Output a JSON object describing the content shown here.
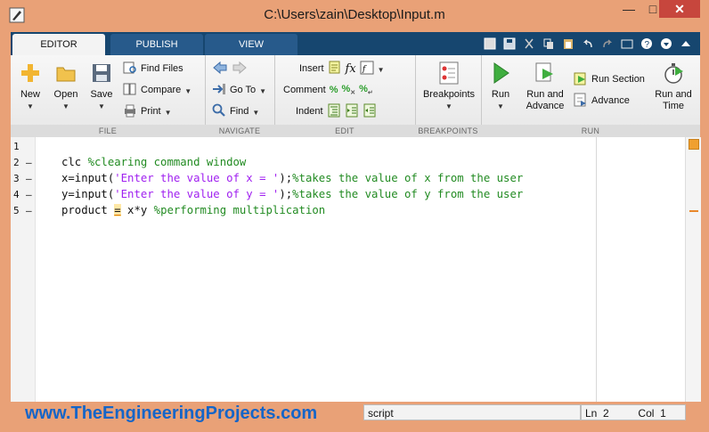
{
  "window": {
    "title": "C:\\Users\\zain\\Desktop\\Input.m",
    "minimize": "—",
    "maximize": "□",
    "close": "✕"
  },
  "tabs": [
    {
      "label": "EDITOR"
    },
    {
      "label": "PUBLISH"
    },
    {
      "label": "VIEW"
    }
  ],
  "ribbon": {
    "file": {
      "label": "FILE",
      "new": "New",
      "open": "Open",
      "save": "Save",
      "find_files": "Find Files",
      "compare": "Compare",
      "print": "Print"
    },
    "navigate": {
      "label": "NAVIGATE",
      "go_to": "Go To",
      "find": "Find"
    },
    "edit": {
      "label": "EDIT",
      "insert": "Insert",
      "comment": "Comment",
      "indent": "Indent"
    },
    "breakpoints": {
      "label": "BREAKPOINTS",
      "breakpoints": "Breakpoints"
    },
    "run": {
      "label": "RUN",
      "run": "Run",
      "run_and_advance_1": "Run and",
      "run_and_advance_2": "Advance",
      "run_section": "Run Section",
      "advance": "Advance",
      "run_and_time_1": "Run and",
      "run_and_time_2": "Time"
    }
  },
  "code": {
    "line_numbers": [
      "1",
      "2",
      "3",
      "4",
      "5"
    ],
    "markers": [
      "",
      "–",
      "–",
      "–",
      "–"
    ],
    "lines": [
      {
        "text": ""
      },
      {
        "kw": "clc ",
        "comment": "%clearing command window"
      },
      {
        "kw": "x=input(",
        "str": "'Enter the value of x = '",
        "rest": ");",
        "comment": "%takes the value of x from the user"
      },
      {
        "kw": "y=input(",
        "str": "'Enter the value of y = '",
        "rest": ");",
        "comment": "%takes the value of y from the user"
      },
      {
        "kw": "product ",
        "mark": "=",
        "rest": " x*y ",
        "comment": "%performing multiplication"
      }
    ]
  },
  "status": {
    "website": "www.TheEngineeringProjects.com",
    "type": "script",
    "ln_label": "Ln",
    "ln_value": "2",
    "col_label": "Col",
    "col_value": "1"
  },
  "colors": {
    "frame": "#e9a177",
    "tabbar": "#16466f",
    "string": "#a020f0",
    "comment": "#228b22",
    "website": "#1565c8"
  }
}
